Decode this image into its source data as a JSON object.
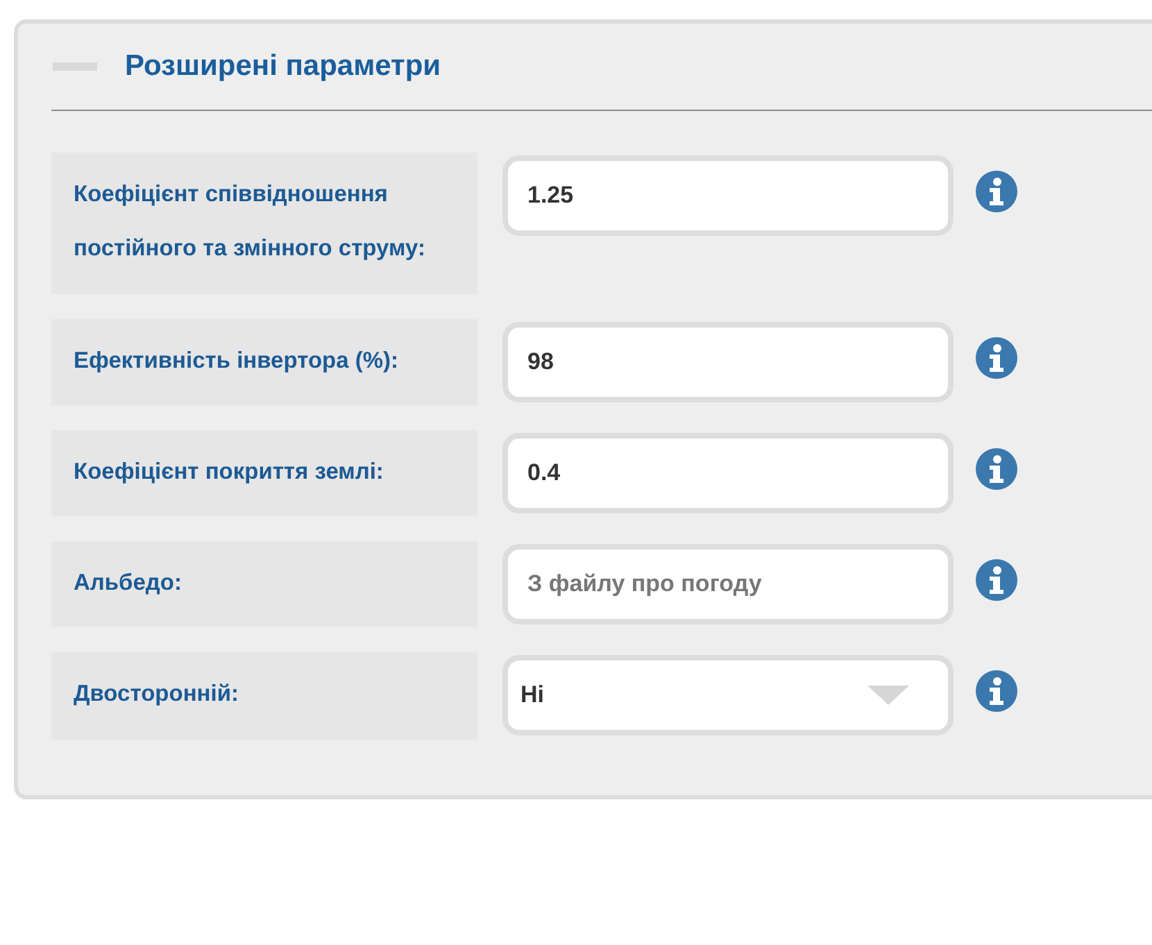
{
  "panel": {
    "title": "Розширені параметри",
    "expanded": true,
    "fields": [
      {
        "label": "Коефіцієнт співвідношення постійного та змінного струму:",
        "kind": "text",
        "value": "1.25"
      },
      {
        "label": "Ефективність інвертора (%):",
        "kind": "text",
        "value": "98"
      },
      {
        "label": "Коефіцієнт покриття землі:",
        "kind": "text",
        "value": "0.4"
      },
      {
        "label": "Альбедо:",
        "kind": "text",
        "placeholder": "З файлу про погоду"
      },
      {
        "label": "Двосторонній:",
        "kind": "select",
        "value": "Ні"
      }
    ]
  }
}
